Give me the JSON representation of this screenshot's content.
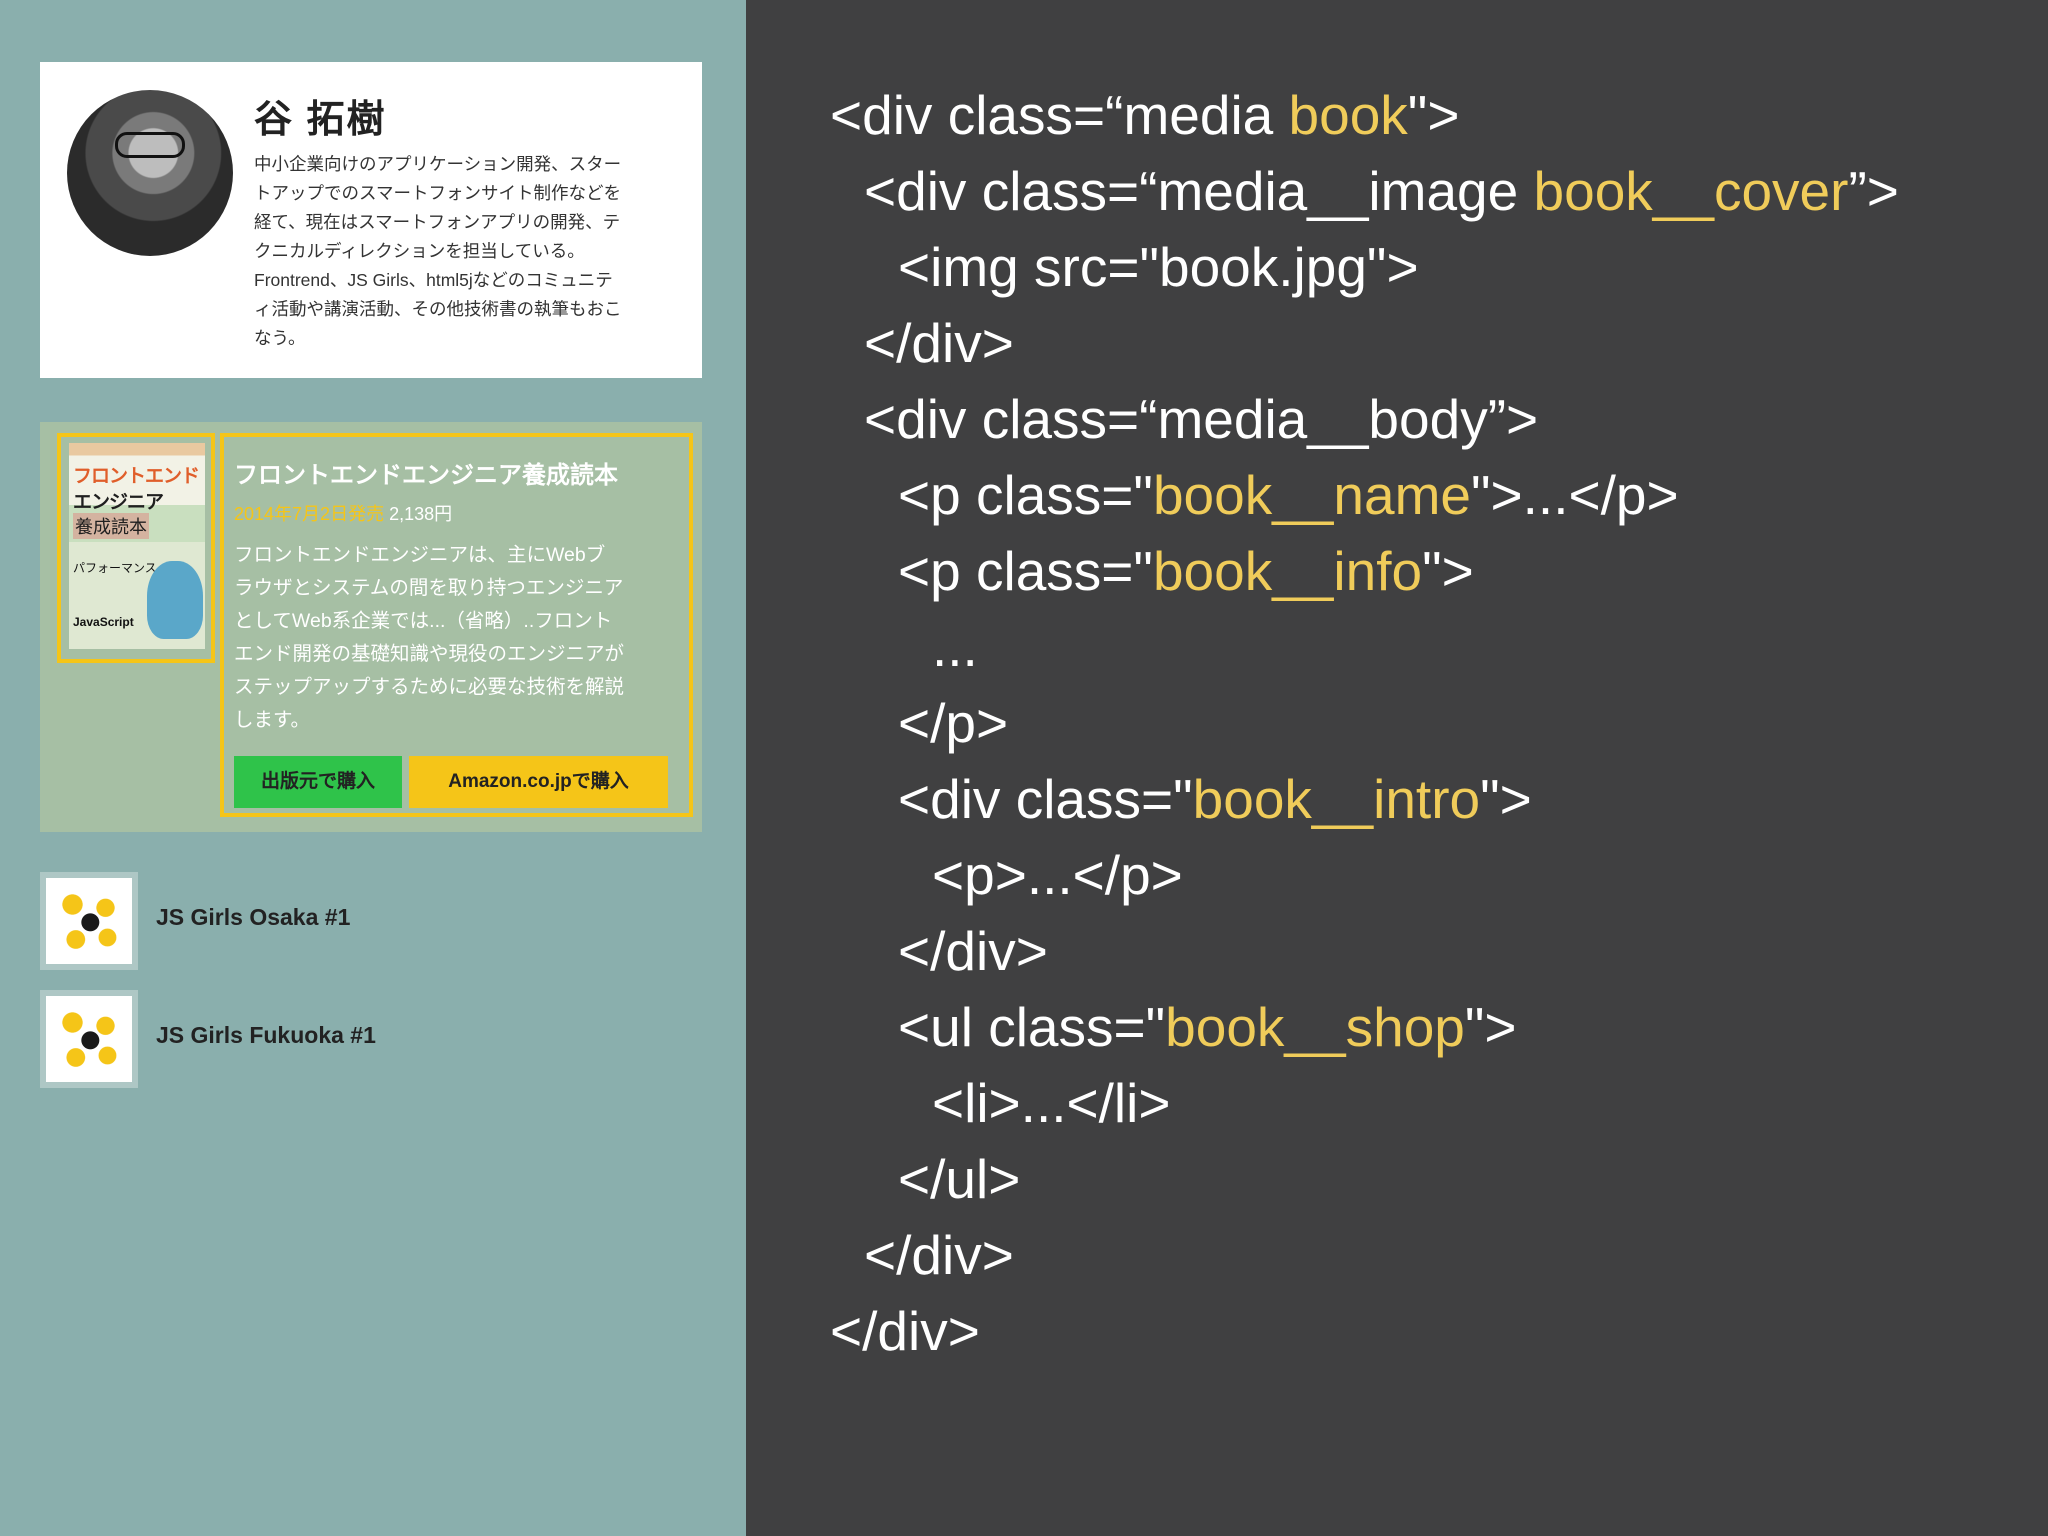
{
  "profile": {
    "name": "谷 拓樹",
    "bio": "中小企業向けのアプリケーション開発、スター\nトアップでのスマートフォンサイト制作などを\n経て、現在はスマートフォンアプリの開発、テ\nクニカルディレクションを担当している。\nFrontrend、JS Girls、html5jなどのコミュニテ\nィ活動や講演活動、その他技術書の執筆もおこ\nなう。"
  },
  "book": {
    "cover": {
      "title_line1": "フロントエンド",
      "title_line2": "エンジニア",
      "title_line3": "養成読本",
      "subtitle": "パフォーマンス",
      "footer": "JavaScript"
    },
    "name": "フロントエンドエンジニア養成読本",
    "date": "2014年7月2日発売",
    "price": "2,138円",
    "intro": "フロントエンドエンジニアは、主にWebブ\nラウザとシステムの間を取り持つエンジニア\nとしてWeb系企業では...（省略）..フロント\nエンド開発の基礎知識や現役のエンジニアが\nステップアップするために必要な技術を解説\nします。",
    "shops": {
      "publisher": "出版元で購入",
      "amazon": "Amazon.co.jpで購入"
    }
  },
  "events": [
    {
      "title": "JS Girls Osaka #1"
    },
    {
      "title": "JS Girls Fukuoka #1"
    }
  ],
  "code": {
    "l1": {
      "a": "<div class=“media ",
      "h": "book",
      "b": "\">"
    },
    "l2": {
      "a": "<div class=“media__image ",
      "h": "book__cover",
      "b": "”>"
    },
    "l3": {
      "a": "<img src=\"book.jpg\">"
    },
    "l4": {
      "a": "</div>"
    },
    "l5": {
      "a": "<div class=“media__body”>"
    },
    "l6": {
      "a": "<p class=\"",
      "h": "book__name",
      "b": "\">...</p>"
    },
    "l7": {
      "a": "<p class=\"",
      "h": "book__info",
      "b": "\">"
    },
    "l8": {
      "a": "..."
    },
    "l9": {
      "a": "</p>"
    },
    "l10": {
      "a": "<div class=\"",
      "h": "book__intro",
      "b": "\">"
    },
    "l11": {
      "a": "<p>...</p>"
    },
    "l12": {
      "a": "</div>"
    },
    "l13": {
      "a": "<ul class=\"",
      "h": "book__shop",
      "b": "\">"
    },
    "l14": {
      "a": "<li>...</li>"
    },
    "l15": {
      "a": "</ul>"
    },
    "l16": {
      "a": "</div>"
    },
    "l17": {
      "a": "</div>"
    }
  },
  "colors": {
    "left_bg": "#8aafad",
    "code_bg": "#404041",
    "highlight": "#f0cc5a",
    "frame": "#f5c518",
    "publisher_btn": "#2fc34a",
    "amazon_btn": "#f5c518"
  }
}
